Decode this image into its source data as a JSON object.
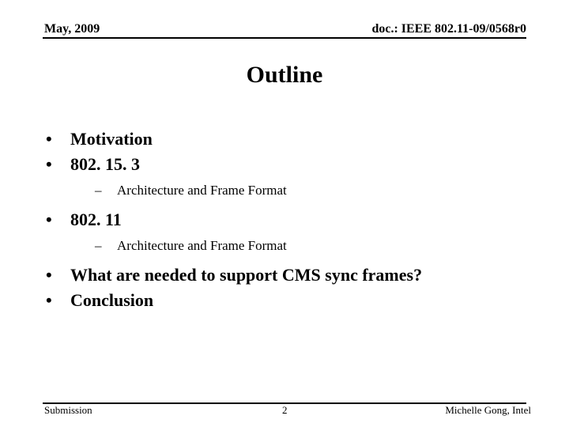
{
  "header": {
    "date": "May, 2009",
    "doc_id": "doc.: IEEE 802.11-09/0568r0"
  },
  "slide": {
    "title": "Outline",
    "bullet_glyph": "•",
    "sub_glyph": "–",
    "items": [
      {
        "label": "Motivation",
        "subitems": []
      },
      {
        "label": "802. 15. 3",
        "subitems": [
          "Architecture and Frame Format"
        ]
      },
      {
        "label": "802. 11",
        "subitems": [
          "Architecture and Frame Format"
        ]
      },
      {
        "label": "What are needed to support CMS sync frames?",
        "subitems": []
      },
      {
        "label": "Conclusion",
        "subitems": []
      }
    ]
  },
  "footer": {
    "left": "Submission",
    "page_number": "2",
    "author": "Michelle Gong, Intel"
  }
}
